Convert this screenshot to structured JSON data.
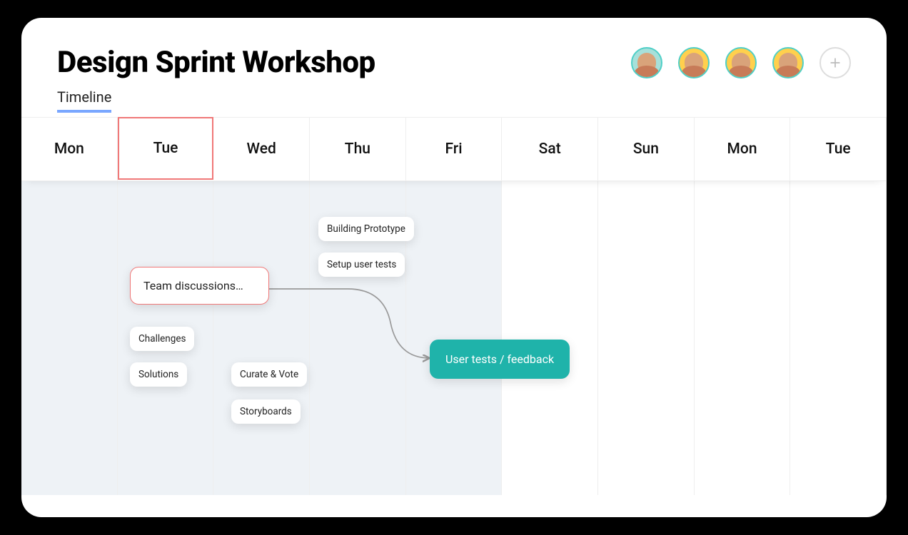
{
  "header": {
    "title": "Design Sprint Workshop"
  },
  "tabs": {
    "timeline": "Timeline"
  },
  "days": [
    "Mon",
    "Tue",
    "Wed",
    "Thu",
    "Fri",
    "Sat",
    "Sun",
    "Mon",
    "Tue"
  ],
  "current_day_index": 1,
  "cards": {
    "team_discussions": "Team discussions…",
    "challenges": "Challenges",
    "solutions": "Solutions",
    "curate_vote": "Curate & Vote",
    "storyboards": "Storyboards",
    "building_prototype": "Building Prototype",
    "setup_user_tests": "Setup user tests",
    "user_tests_feedback": "User tests / feedback"
  },
  "colors": {
    "accent_teal": "#1fb3aa",
    "highlight_red": "#f07878",
    "tab_underline": "#7aa7ff"
  },
  "avatar_count": 4
}
